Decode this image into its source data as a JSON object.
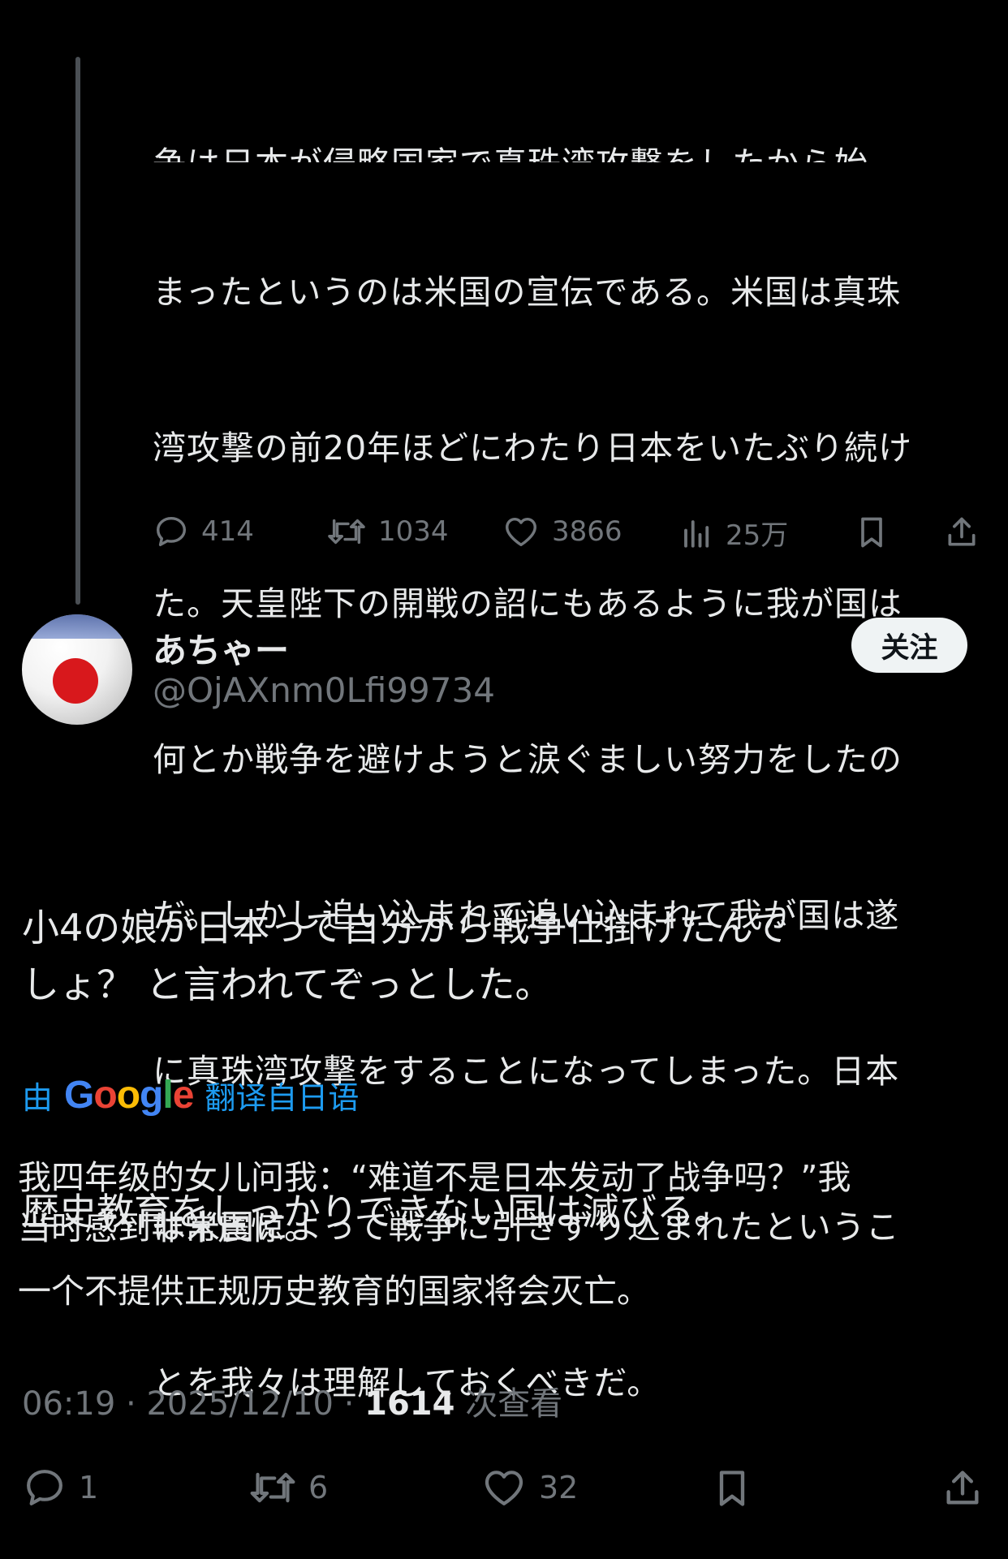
{
  "previous_tweet": {
    "partial_line": "争は日本が侵略国家で真珠湾攻撃をしたから始",
    "lines": [
      "まったというのは米国の宣伝である。米国は真珠",
      "湾攻撃の前20年ほどにわたり日本をいたぶり続け",
      "た。天皇陛下の開戦の詔にもあるように我が国は",
      "何とか戦争を避けようと涙ぐましい努力をしたの",
      "だ。しかし追い込まれて追い込まれて我が国は遂",
      "に真珠湾攻撃をすることになってしまった。日本",
      "は米国によって戦争に引きずり込まれたというこ",
      "とを我々は理解しておくべきだ。"
    ],
    "actions": {
      "replies": "414",
      "retweets": "1034",
      "likes": "3866",
      "views": "25万"
    }
  },
  "tweet": {
    "display_name": "あちゃー",
    "handle": "@OjAXnm0Lfi99734",
    "follow_label": "关注",
    "text_lines": [
      "小4の娘が日本って自分から戦争仕掛けたんで\nしょ？ と言われてぞっとした。",
      "歴史教育をしっかりできない国は滅びる。"
    ],
    "translation": {
      "prefix": "由",
      "brand": "Google",
      "suffix": "翻译自日语",
      "lines": [
        "我四年级的女儿问我：“难道不是日本发动了战争吗？”我\n当时感到非常震惊。",
        "一个不提供正规历史教育的国家将会灭亡。"
      ]
    },
    "meta": {
      "time": "06:19",
      "date": "2025/12/10",
      "views_count": "1614",
      "views_label": "次查看"
    },
    "actions": {
      "replies": "1",
      "retweets": "6",
      "likes": "32"
    }
  },
  "colors": {
    "background": "#000000",
    "text": "#e7e9ea",
    "secondary": "#71767b",
    "link": "#1d9bf0",
    "thread_line": "#4a4f54"
  },
  "icons": [
    "reply-icon",
    "retweet-icon",
    "like-icon",
    "views-icon",
    "bookmark-icon",
    "share-icon"
  ]
}
